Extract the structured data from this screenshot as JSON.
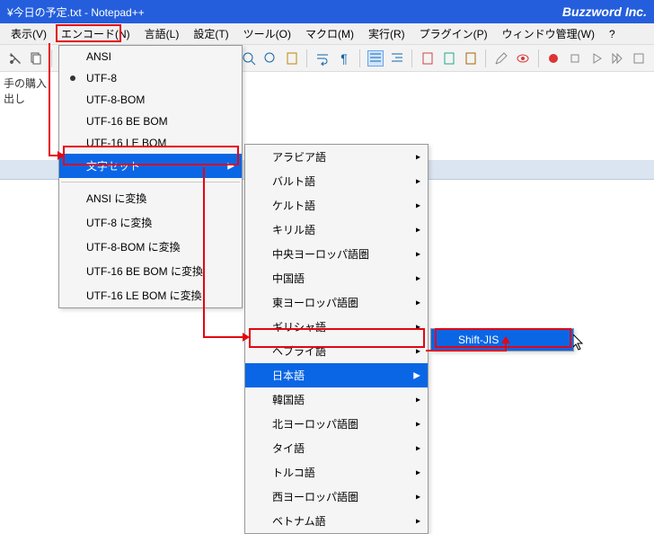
{
  "title": "¥今日の予定.txt - Notepad++",
  "brand": "Buzzword Inc.",
  "menubar": [
    "表示(V)",
    "エンコード(N)",
    "言語(L)",
    "設定(T)",
    "ツール(O)",
    "マクロ(M)",
    "実行(R)",
    "プラグイン(P)",
    "ウィンドウ管理(W)",
    "?"
  ],
  "editor_sidebar_line1": "手の購入",
  "editor_sidebar_line2": "出し",
  "dropdown1": {
    "items": [
      "ANSI",
      "UTF-8",
      "UTF-8-BOM",
      "UTF-16 BE BOM",
      "UTF-16 LE BOM"
    ],
    "submenu": "文字セット",
    "convert": [
      "ANSI に変換",
      "UTF-8 に変換",
      "UTF-8-BOM に変換",
      "UTF-16 BE BOM に変換",
      "UTF-16 LE BOM に変換"
    ]
  },
  "dropdown2": {
    "items": [
      "アラビア語",
      "バルト語",
      "ケルト語",
      "キリル語",
      "中央ヨーロッパ語圏",
      "中国語",
      "東ヨーロッパ語圏",
      "ギリシャ語",
      "ヘブライ語",
      "日本語",
      "韓国語",
      "北ヨーロッパ語圏",
      "タイ語",
      "トルコ語",
      "西ヨーロッパ語圏",
      "ベトナム語"
    ],
    "selected_index": 9
  },
  "dropdown3": {
    "item": "Shift-JIS"
  }
}
